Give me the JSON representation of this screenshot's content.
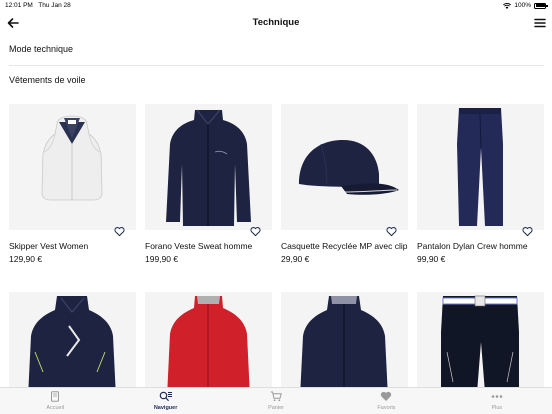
{
  "status_bar": {
    "time": "12:01 PM",
    "date": "Thu Jan 28",
    "battery": "100%",
    "wifi_icon": "wifi-icon",
    "battery_icon": "battery-icon"
  },
  "header": {
    "title": "Technique",
    "back_icon": "arrow-left-icon",
    "menu_icon": "hamburger-menu-icon"
  },
  "categories": [
    {
      "label": "Mode technique"
    },
    {
      "label": "Vêtements de voile"
    }
  ],
  "products": [
    {
      "name": "Skipper Vest Women",
      "price": "129,90 €"
    },
    {
      "name": "Forano Veste Sweat homme",
      "price": "199,90 €"
    },
    {
      "name": "Casquette Recyclée MP avec clip",
      "price": "29,90 €"
    },
    {
      "name": "Pantalon Dylan Crew homme",
      "price": "99,90 €"
    },
    {
      "name": "",
      "price": ""
    },
    {
      "name": "",
      "price": ""
    },
    {
      "name": "",
      "price": ""
    },
    {
      "name": "",
      "price": ""
    }
  ],
  "tabs": [
    {
      "label": "Accueil",
      "icon": "book-icon",
      "active": false
    },
    {
      "label": "Naviguer",
      "icon": "search-list-icon",
      "active": true
    },
    {
      "label": "Panier",
      "icon": "cart-icon",
      "active": false
    },
    {
      "label": "Favoris",
      "icon": "heart-icon",
      "active": false
    },
    {
      "label": "Plus",
      "icon": "more-dots-icon",
      "active": false
    }
  ],
  "colors": {
    "accent": "#1e2a55",
    "navy_product": "#1d2340",
    "red_product": "#d0202a",
    "tab_inactive": "#9a9a9a"
  }
}
